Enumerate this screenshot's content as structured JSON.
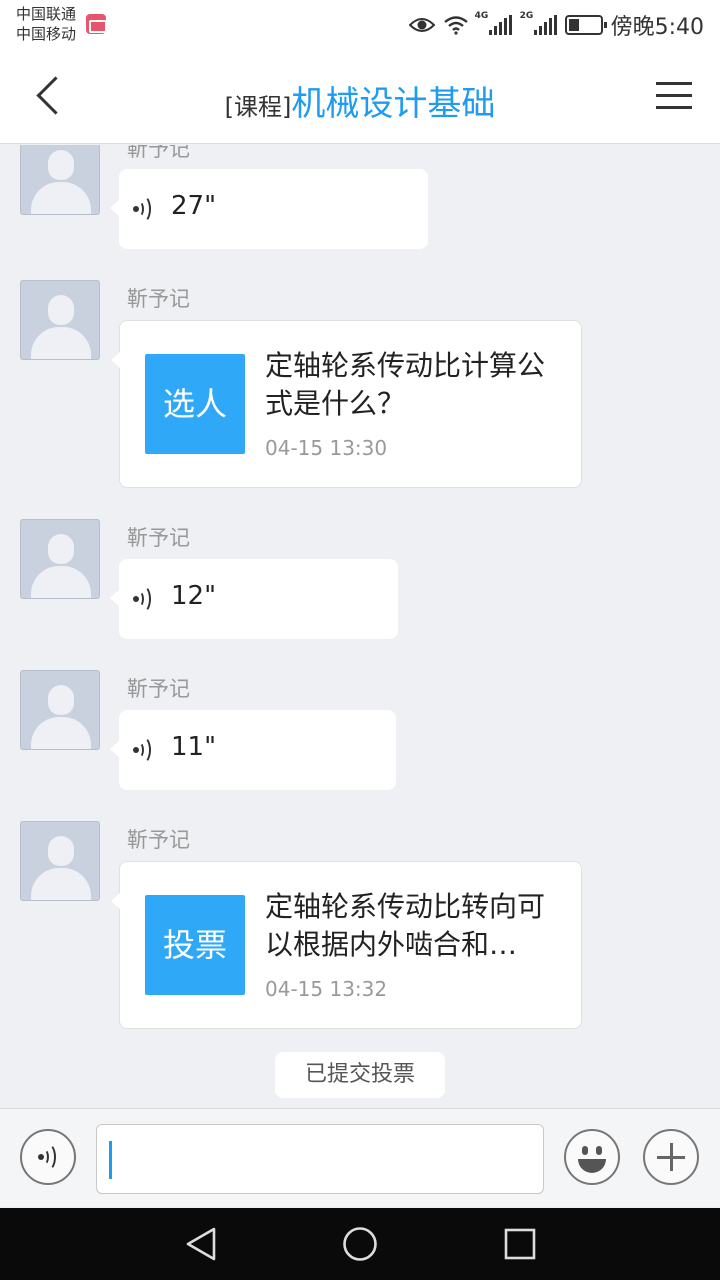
{
  "status_bar": {
    "carrier1": "中国联通",
    "carrier2": "中国移动",
    "net1": "4G",
    "net2": "2G",
    "time": "傍晚5:40"
  },
  "header": {
    "prefix": "[课程]",
    "title": "机械设计基础"
  },
  "messages": [
    {
      "sender": "靳予记",
      "type": "voice",
      "duration": "27\""
    },
    {
      "sender": "靳予记",
      "type": "card",
      "badge": "选人",
      "text": "定轴轮系传动比计算公式是什么？",
      "time": "04-15 13:30"
    },
    {
      "sender": "靳予记",
      "type": "voice",
      "duration": "12\""
    },
    {
      "sender": "靳予记",
      "type": "voice",
      "duration": "11\""
    },
    {
      "sender": "靳予记",
      "type": "card",
      "badge": "投票",
      "text": "定轴轮系传动比转向可以根据内外啮合和…",
      "time": "04-15 13:32"
    }
  ],
  "system_note": "已提交投票",
  "input": {
    "value": ""
  },
  "colors": {
    "accent": "#1f9bf0",
    "badge": "#2fa8f8"
  }
}
